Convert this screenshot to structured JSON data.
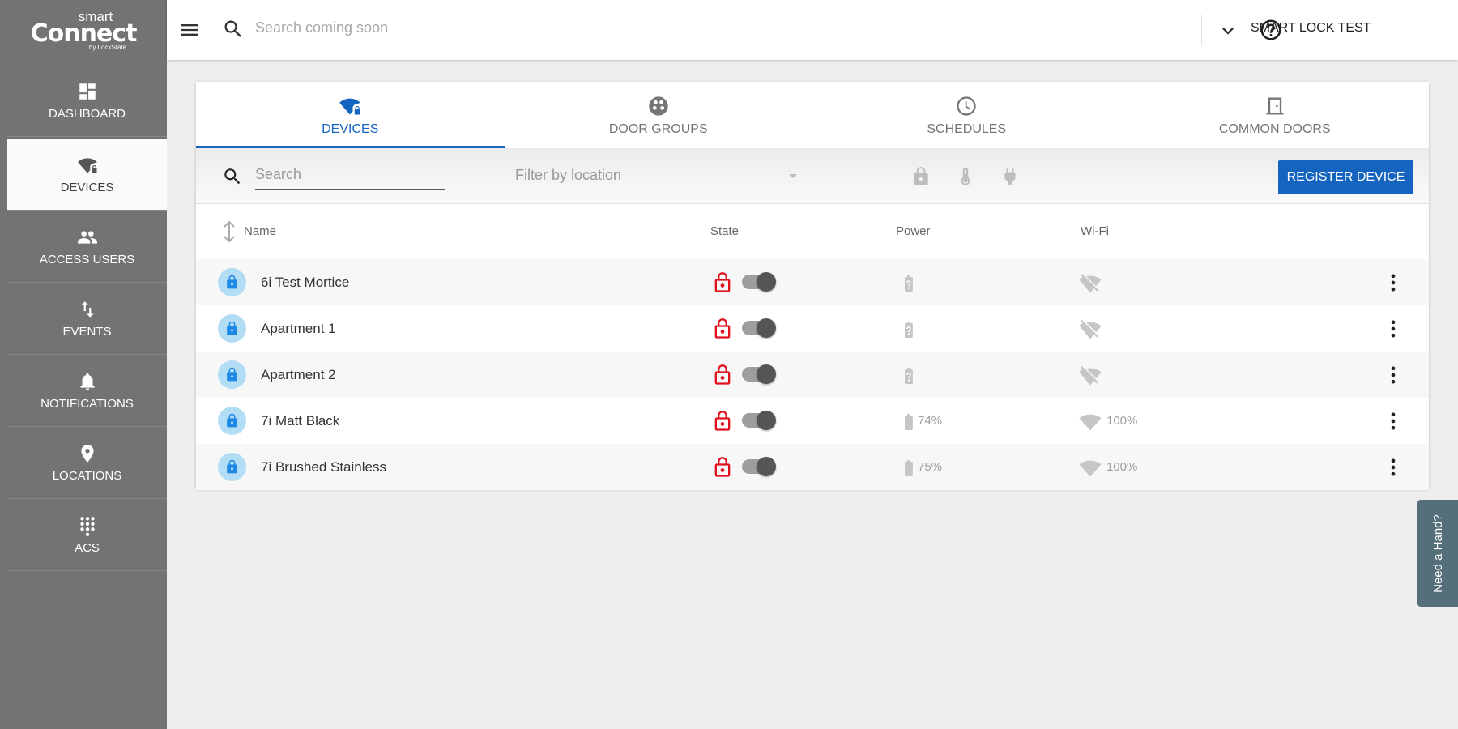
{
  "brand": {
    "line1": "smart",
    "line2": "Connect",
    "line3": "by LockState"
  },
  "sidebar": {
    "items": [
      {
        "label": "DASHBOARD",
        "icon": "dashboard-icon"
      },
      {
        "label": "DEVICES",
        "icon": "wifi-lock-icon",
        "active": true
      },
      {
        "label": "ACCESS USERS",
        "icon": "people-icon"
      },
      {
        "label": "EVENTS",
        "icon": "swap-vertical-icon"
      },
      {
        "label": "NOTIFICATIONS",
        "icon": "bell-icon"
      },
      {
        "label": "LOCATIONS",
        "icon": "map-pin-icon"
      },
      {
        "label": "ACS",
        "icon": "keypad-icon"
      }
    ]
  },
  "topbar": {
    "search_placeholder": "Search coming soon",
    "account": "SMART LOCK TEST"
  },
  "tabs": [
    {
      "label": "DEVICES",
      "icon": "wifi-lock-icon",
      "active": true
    },
    {
      "label": "DOOR GROUPS",
      "icon": "door-groups-icon"
    },
    {
      "label": "SCHEDULES",
      "icon": "clock-icon"
    },
    {
      "label": "COMMON DOORS",
      "icon": "door-icon"
    }
  ],
  "filters": {
    "search_placeholder": "Search",
    "location_placeholder": "Filter by location",
    "register_label": "REGISTER DEVICE"
  },
  "table": {
    "headers": {
      "name": "Name",
      "state": "State",
      "power": "Power",
      "wifi": "Wi-Fi"
    },
    "rows": [
      {
        "name": "6i Test Mortice",
        "power": "",
        "wifi": ""
      },
      {
        "name": "Apartment 1",
        "power": "",
        "wifi": ""
      },
      {
        "name": "Apartment 2",
        "power": "",
        "wifi": ""
      },
      {
        "name": "7i Matt Black",
        "power": "74%",
        "wifi": "100%"
      },
      {
        "name": "7i Brushed Stainless",
        "power": "75%",
        "wifi": "100%"
      }
    ]
  },
  "help_tab": "Need a Hand?",
  "colors": {
    "accent": "#1565c0",
    "sidebar": "#737373",
    "locked": "#e0101d"
  }
}
